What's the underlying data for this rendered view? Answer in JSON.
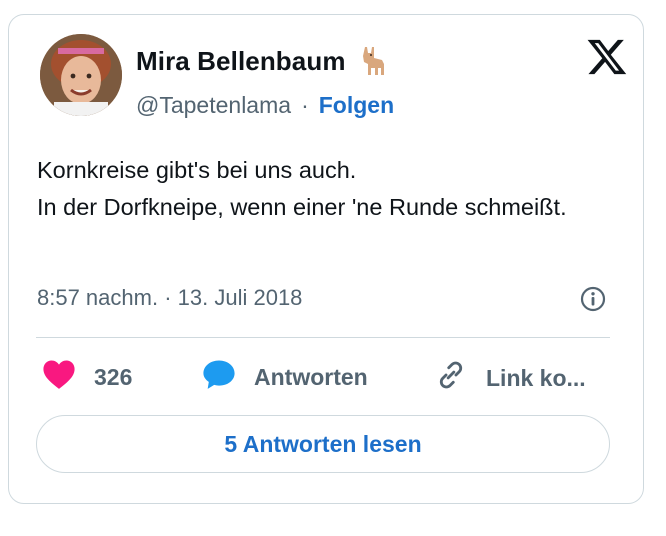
{
  "tweet": {
    "author_name": "Mira Bellenbaum",
    "author_emoji": "🦙",
    "handle": "@Tapetenlama",
    "separator": "·",
    "follow_label": "Folgen",
    "text": "Kornkreise gibt's bei uns auch.\nIn der Dorfkneipe, wenn einer 'ne Runde schmeißt.",
    "time": "8:57 nachm.",
    "date": "13. Juli 2018",
    "meta_separator": "·"
  },
  "actions": {
    "like_count": "326",
    "reply_label": "Antworten",
    "copy_label": "Link ko..."
  },
  "read_replies_label": "5 Antworten lesen",
  "colors": {
    "accent": "#1d6fc9",
    "like": "#f91880",
    "reply": "#1d9bf0",
    "secondary_text": "#536471",
    "border": "#cfd9de"
  },
  "icons": [
    "x-logo-icon",
    "llama-emoji-icon",
    "info-icon",
    "heart-icon",
    "speech-bubble-icon",
    "link-icon"
  ]
}
